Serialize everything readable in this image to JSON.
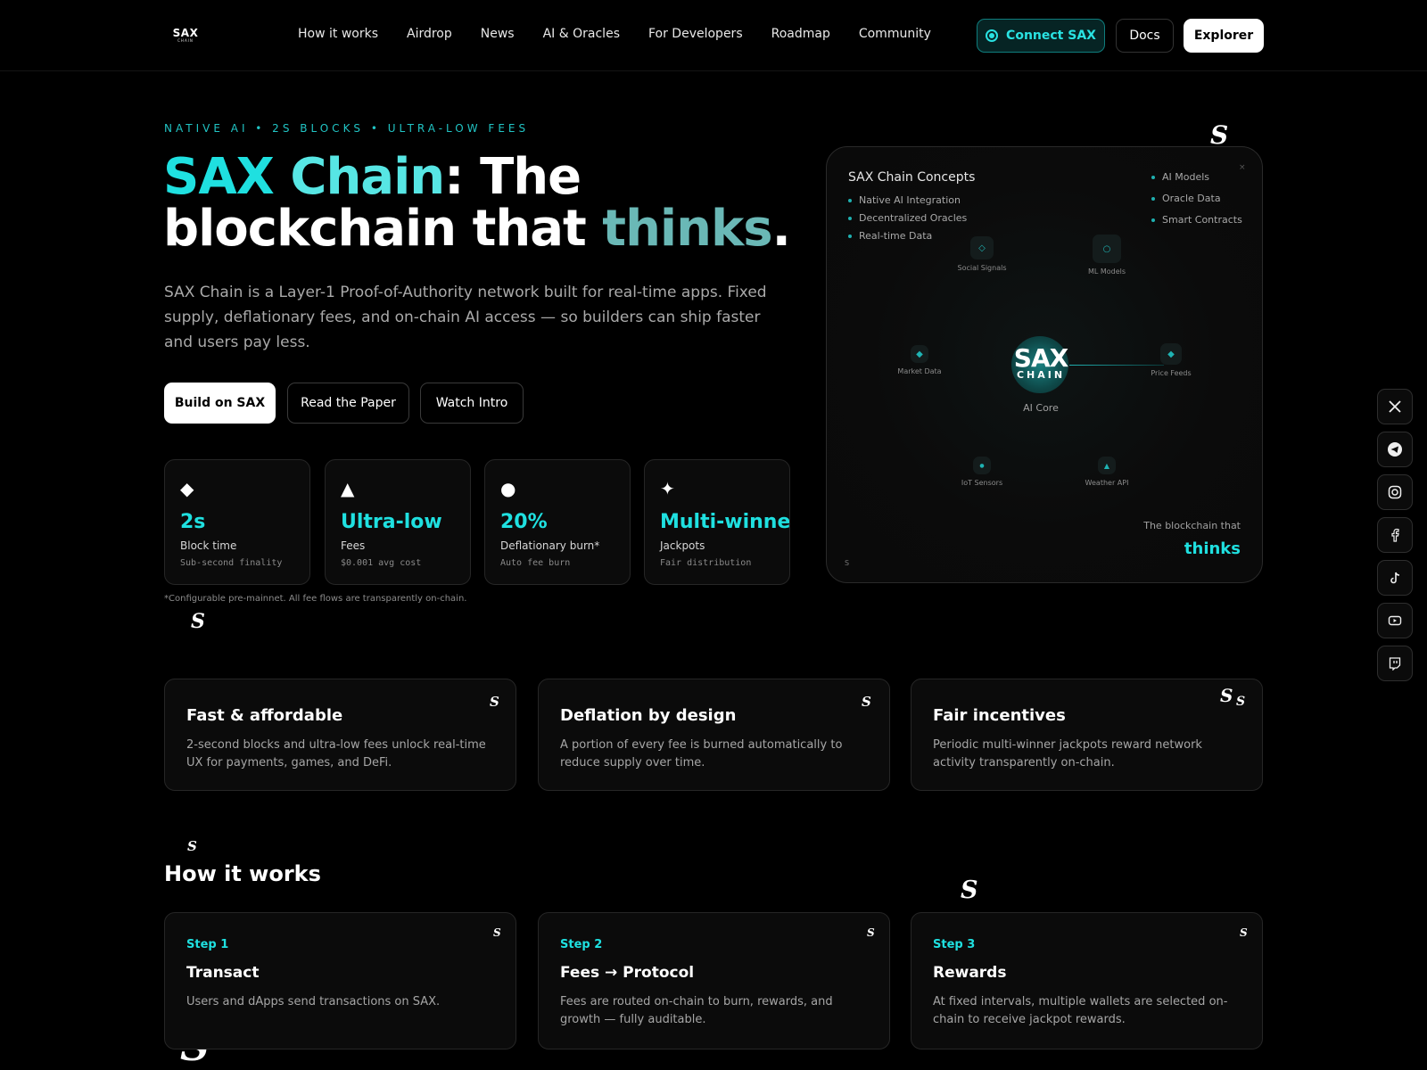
{
  "nav": {
    "logo_main": "SAX",
    "logo_sub": "CHAIN",
    "links": [
      "How it works",
      "Airdrop",
      "News",
      "AI & Oracles",
      "For Developers",
      "Roadmap",
      "Community"
    ],
    "connect_label": "Connect SAX",
    "docs_label": "Docs",
    "explorer_label": "Explorer"
  },
  "hero": {
    "eyebrow": "NATIVE AI • 2S BLOCKS • ULTRA-LOW FEES",
    "title_part1": "SAX ",
    "title_part2": "Chain",
    "title_part3": ": The",
    "title_line2_a": "blockchain that ",
    "title_line2_b": "thinks",
    "title_line2_c": ".",
    "description": "SAX Chain is a Layer-1 Proof-of-Authority network built for real-time apps. Fixed supply, deflationary fees, and on-chain AI access — so builders can ship faster and users pay less.",
    "btn_build": "Build on SAX",
    "btn_paper": "Read the Paper",
    "btn_intro": "Watch Intro"
  },
  "stats": [
    {
      "icon": "◆",
      "value": "2s",
      "label": "Block time",
      "sub": "Sub-second finality"
    },
    {
      "icon": "▲",
      "value": "Ultra-low",
      "label": "Fees",
      "sub": "$0.001 avg cost"
    },
    {
      "icon": "●",
      "value": "20%",
      "label": "Deflationary burn*",
      "sub": "Auto fee burn"
    },
    {
      "icon": "✦",
      "value": "Multi-winner",
      "label": "Jackpots",
      "sub": "Fair distribution"
    }
  ],
  "footnote": "*Configurable pre-mainnet. All fee flows are transparently on-chain.",
  "panel": {
    "title": "SAX Chain Concepts",
    "left_list": [
      "Native AI Integration",
      "Decentralized Oracles",
      "Real-time Data"
    ],
    "right_list": [
      "AI Models",
      "Oracle Data",
      "Smart Contracts"
    ],
    "close": "×",
    "nodes": {
      "social": "Social Signals",
      "ml": "ML Models",
      "market": "Market Data",
      "price": "Price Feeds",
      "iot": "IoT Sensors",
      "weather": "Weather API"
    },
    "core_logo_main": "SAX",
    "core_logo_sub": "CHAIN",
    "core_label": "AI Core",
    "tagline_1": "The blockchain that",
    "tagline_2": "thinks",
    "corner_mark": "S"
  },
  "social_icons": [
    "x-icon",
    "telegram-icon",
    "instagram-icon",
    "facebook-icon",
    "tiktok-icon",
    "youtube-icon",
    "twitch-icon"
  ],
  "features": [
    {
      "title": "Fast & affordable",
      "desc": "2-second blocks and ultra-low fees unlock real-time UX for payments, games, and DeFi."
    },
    {
      "title": "Deflation by design",
      "desc": "A portion of every fee is burned automatically to reduce supply over time."
    },
    {
      "title": "Fair incentives",
      "desc": "Periodic multi-winner jackpots reward network activity transparently on-chain."
    }
  ],
  "how": {
    "title": "How it works",
    "steps": [
      {
        "label": "Step 1",
        "title": "Transact",
        "desc": "Users and dApps send transactions on SAX."
      },
      {
        "label": "Step 2",
        "title": "Fees → Protocol",
        "desc": "Fees are routed on-chain to burn, rewards, and growth — fully auditable."
      },
      {
        "label": "Step 3",
        "title": "Rewards",
        "desc": "At fixed intervals, multiple wallets are selected on-chain to receive jackpot rewards."
      }
    ]
  },
  "colors": {
    "accent": "#1fe0e0",
    "background": "#000000",
    "card": "#0b0b0b"
  }
}
